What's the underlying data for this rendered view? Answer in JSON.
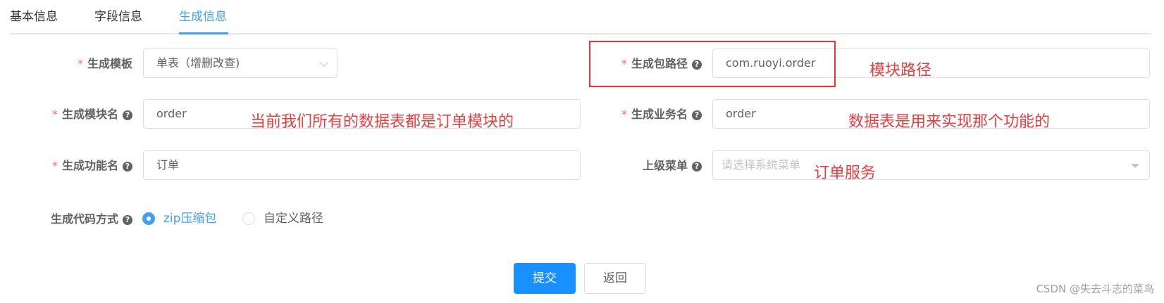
{
  "tabs": [
    {
      "label": "基本信息",
      "active": false
    },
    {
      "label": "字段信息",
      "active": false
    },
    {
      "label": "生成信息",
      "active": true
    }
  ],
  "form": {
    "template": {
      "label": "生成模板",
      "required": true,
      "value": "单表（增删改查)"
    },
    "package_path": {
      "label": "生成包路径",
      "required": true,
      "value": "com.ruoyi.order"
    },
    "module_name": {
      "label": "生成模块名",
      "required": true,
      "value": "order"
    },
    "business_name": {
      "label": "生成业务名",
      "required": true,
      "value": "order"
    },
    "function_name": {
      "label": "生成功能名",
      "required": true,
      "value": "订单"
    },
    "parent_menu": {
      "label": "上级菜单",
      "required": false,
      "placeholder": "请选择系统菜单"
    },
    "gen_type": {
      "label": "生成代码方式",
      "options": [
        {
          "label": "zip压缩包",
          "checked": true
        },
        {
          "label": "自定义路径",
          "checked": false
        }
      ]
    }
  },
  "annotations": {
    "package_path": "模块路径",
    "module_name": "当前我们所有的数据表都是订单模块的",
    "business_name": "数据表是用来实现那个功能的",
    "parent_menu": "订单服务"
  },
  "buttons": {
    "submit": "提交",
    "back": "返回"
  },
  "watermark": "CSDN @失去斗志的菜鸟",
  "colors": {
    "accent": "#409eff",
    "primary_button": "#1890ff",
    "required_star": "#f56c6c",
    "annotation": "#e83e3e"
  }
}
